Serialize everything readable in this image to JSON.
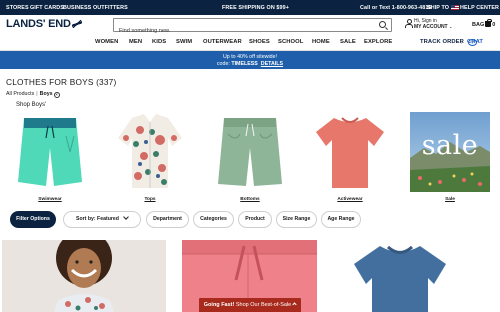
{
  "topbar": {
    "stores": "STORES",
    "gift_cards": "GIFT CARDS",
    "business": "BUSINESS OUTFITTERS",
    "shipping": "FREE SHIPPING ON $99+",
    "call": "Call or Text 1-800-963-4816",
    "ship_to": "SHIP TO",
    "help": "HELP CENTER"
  },
  "header": {
    "logo": "LANDS' END",
    "search_placeholder": "Find something new.",
    "account_line1": "Hi, Sign in",
    "account_line2": "MY ACCOUNT",
    "bag_label": "BAG",
    "bag_count": "0"
  },
  "nav": {
    "items": [
      "WOMEN",
      "MEN",
      "KIDS",
      "SWIM",
      "OUTERWEAR",
      "SHOES",
      "SCHOOL",
      "HOME",
      "SALE",
      "EXPLORE"
    ],
    "track_order": "TRACK ORDER",
    "divider": "|",
    "chat": "CHAT",
    "chat_icon_text": "?"
  },
  "promo": {
    "line1": "Up to 40% off sitewide!",
    "code_prefix": "code: ",
    "code": "TIMELESS",
    "details": "DETAILS"
  },
  "page": {
    "title": "CLOTHES FOR BOYS (337)",
    "breadcrumb_root": "All Products",
    "breadcrumb_sep": "|",
    "breadcrumb_current": "Boys",
    "shop_label": "Shop Boys'"
  },
  "categories": [
    {
      "label": "Swimwear"
    },
    {
      "label": "Tops"
    },
    {
      "label": "Bottoms"
    },
    {
      "label": "Activewear"
    },
    {
      "label": "Sale",
      "image_text": "sale"
    }
  ],
  "filters": {
    "filter_options": "Filter Options",
    "sort": "Sort by: Featured",
    "chips": [
      "Department",
      "Categories",
      "Product",
      "Size Range",
      "Age Range"
    ]
  },
  "toast": {
    "bold": "Going Fast!",
    "text": " Shop Our Best-of-Sale"
  },
  "colors": {
    "navy": "#0b2341",
    "promo_blue": "#1e5eaa",
    "toast_red": "#a72a1c",
    "swim_teal": "#4fd9b8",
    "bottoms_green": "#8fb598",
    "activewear_coral": "#e7776b",
    "tee_blue": "#436f9f"
  }
}
